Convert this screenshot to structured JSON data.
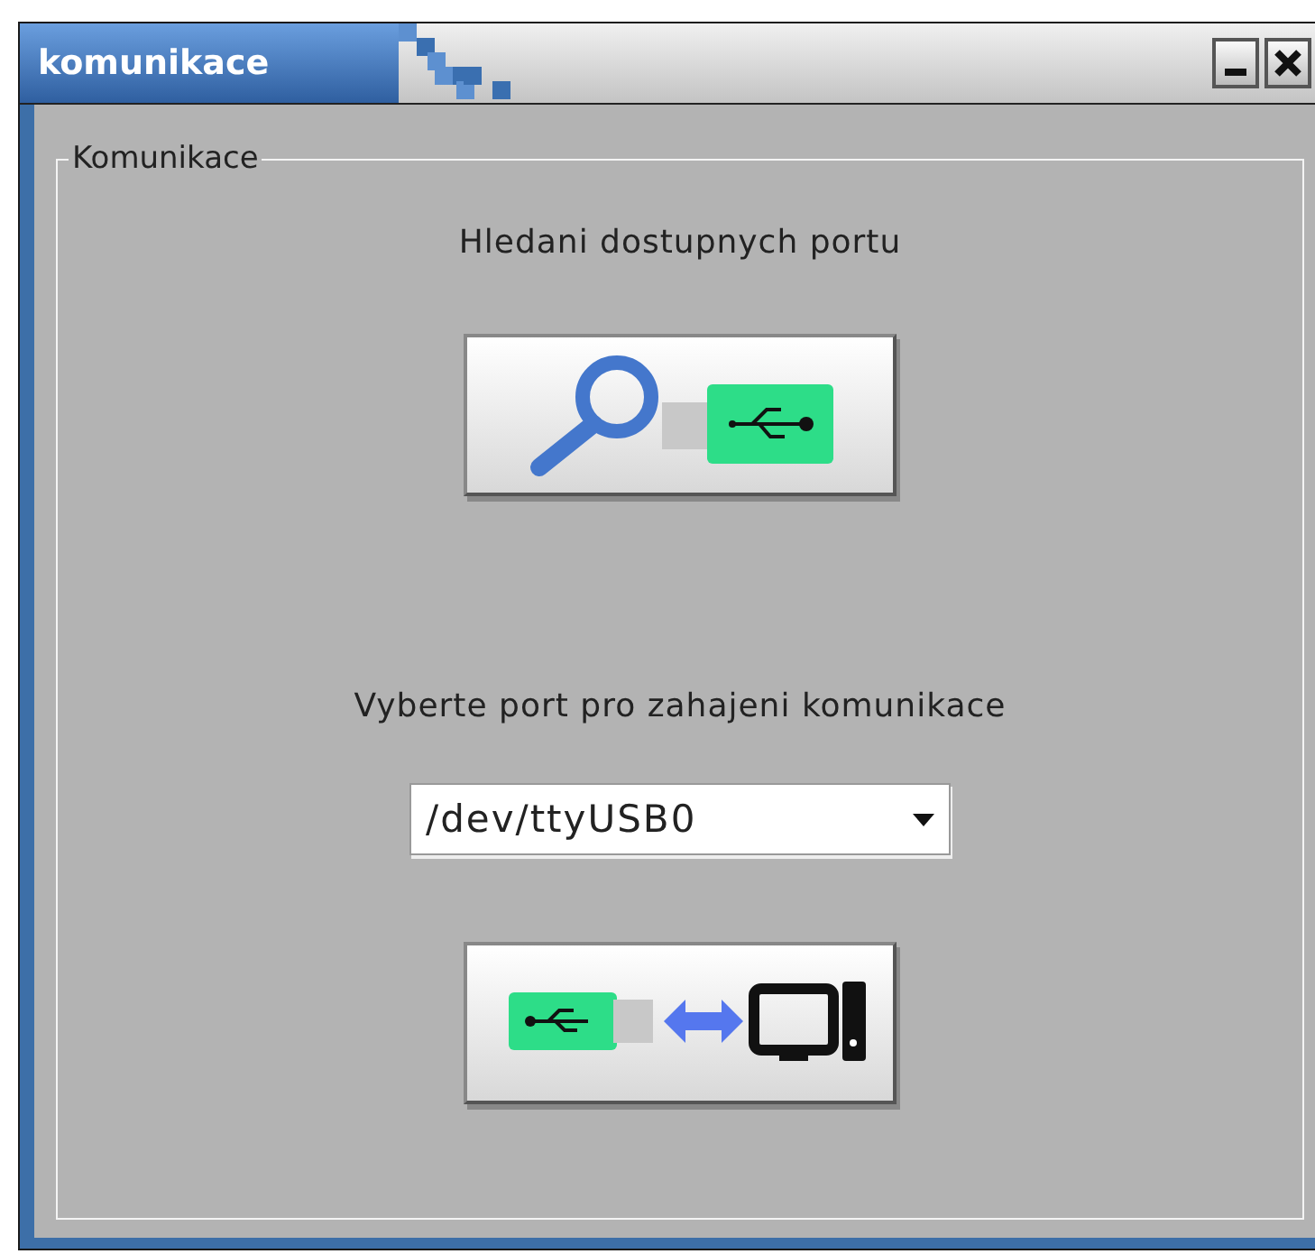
{
  "window": {
    "title": "komunikace"
  },
  "group": {
    "legend": "Komunikace",
    "search_label": "Hledani dostupnych portu",
    "port_label": "Vyberte port pro zahajeni komunikace",
    "port_select": {
      "value": "/dev/ttyUSB0"
    }
  }
}
